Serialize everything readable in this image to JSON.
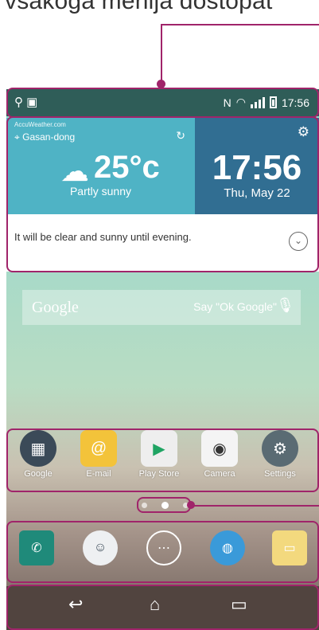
{
  "caption": "vsakoga menija dostopat",
  "status": {
    "time": "17:56"
  },
  "weather": {
    "source": "AccuWeather.com",
    "location": "Gasan-dong",
    "temperature": "25°c",
    "condition": "Partly sunny",
    "forecast": "It will be clear and sunny until evening."
  },
  "clock": {
    "time": "17:56",
    "date": "Thu, May 22"
  },
  "search": {
    "brand": "Google",
    "hint": "Say \"Ok Google\""
  },
  "apps": [
    {
      "label": "Google",
      "icon": "google-folder-icon"
    },
    {
      "label": "E-mail",
      "icon": "email-icon"
    },
    {
      "label": "Play Store",
      "icon": "play-store-icon"
    },
    {
      "label": "Camera",
      "icon": "camera-icon"
    },
    {
      "label": "Settings",
      "icon": "settings-icon"
    }
  ],
  "dock": [
    {
      "icon": "phone-icon"
    },
    {
      "icon": "contacts-icon"
    },
    {
      "icon": "apps-grid-icon"
    },
    {
      "icon": "browser-globe-icon"
    },
    {
      "icon": "messaging-icon"
    }
  ],
  "colors": {
    "annotation": "#a0246a",
    "weather_bg": "#4fb3c5",
    "clock_bg": "#316e92"
  }
}
